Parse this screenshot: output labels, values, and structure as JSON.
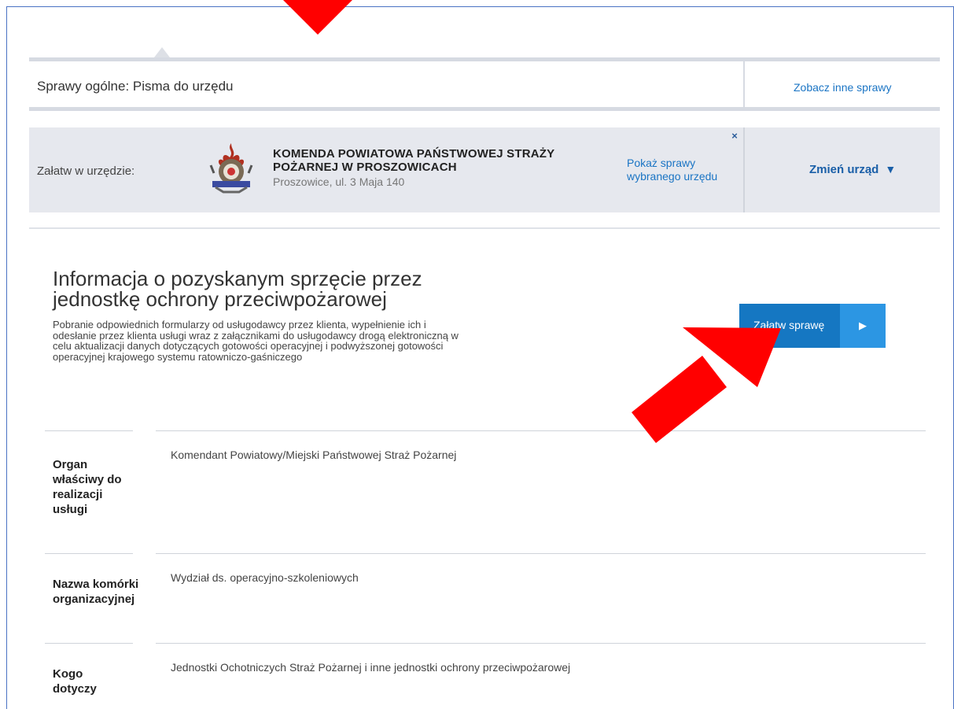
{
  "category": {
    "title": "Sprawy ogólne: Pisma do urzędu",
    "other_link": "Zobacz inne sprawy"
  },
  "office": {
    "label": "Załatw w urzędzie:",
    "name": "KOMENDA POWIATOWA PAŃSTWOWEJ STRAŻY POŻARNEJ W PROSZOWICACH",
    "address": "Proszowice, ul. 3 Maja 140",
    "close_icon": "×",
    "show_link": "Pokaż sprawy wybranego urzędu",
    "change_label": "Zmień urząd",
    "change_icon": "▼"
  },
  "service": {
    "title": "Informacja o pozyskanym sprzęcie przez jednostkę ochrony przeciwpożarowej",
    "description": "Pobranie odpowiednich formularzy od usługodawcy przez klienta, wypełnienie ich i odesłanie przez klienta usługi wraz z załącznikami do usługodawcy drogą elektroniczną w celu aktualizacji danych dotyczących gotowości operacyjnej i podwyższonej gotowości operacyjnej krajowego systemu ratowniczo-gaśniczego",
    "button_label": "Załatw sprawę",
    "button_icon": "▶"
  },
  "details": [
    {
      "key": "Organ właściwy do realizacji usługi",
      "value": "Komendant Powiatowy/Miejski Państwowej Straż Pożarnej"
    },
    {
      "key": "Nazwa komórki organizacyjnej",
      "value": "Wydział ds. operacyjno-szkoleniowych"
    },
    {
      "key": "Kogo dotyczy",
      "value": "Jednostki Ochotniczych Straż Pożarnej i inne jednostki ochrony przeciwpożarowej"
    }
  ],
  "colors": {
    "accent": "#1a87d8",
    "link": "#1a74c4",
    "annotation_arrow": "#ff0000"
  }
}
